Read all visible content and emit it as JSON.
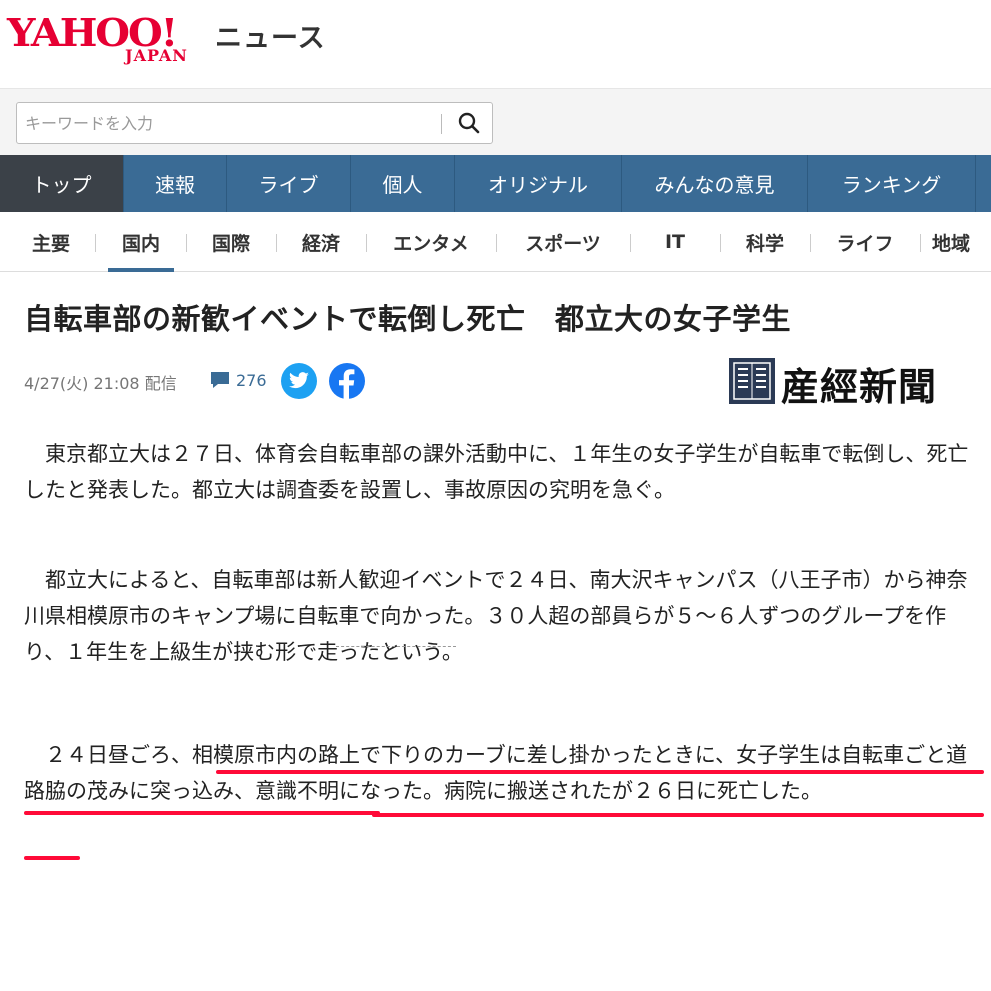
{
  "header": {
    "logo_main": "YAHOO!",
    "logo_sub": "JAPAN",
    "service_name": "ニュース"
  },
  "search": {
    "placeholder": "キーワードを入力",
    "value": "",
    "button_icon": "search-icon"
  },
  "nav_primary": {
    "tabs": [
      {
        "label": "トップ",
        "active": true
      },
      {
        "label": "速報",
        "active": false
      },
      {
        "label": "ライブ",
        "active": false
      },
      {
        "label": "個人",
        "active": false
      },
      {
        "label": "オリジナル",
        "active": false
      },
      {
        "label": "みんなの意見",
        "active": false
      },
      {
        "label": "ランキング",
        "active": false
      }
    ]
  },
  "nav_secondary": {
    "categories": [
      {
        "label": "主要",
        "active": false
      },
      {
        "label": "国内",
        "active": true
      },
      {
        "label": "国際",
        "active": false
      },
      {
        "label": "経済",
        "active": false
      },
      {
        "label": "エンタメ",
        "active": false
      },
      {
        "label": "スポーツ",
        "active": false
      },
      {
        "label": "IT",
        "active": false
      },
      {
        "label": "科学",
        "active": false
      },
      {
        "label": "ライフ",
        "active": false
      },
      {
        "label": "地域",
        "active": false
      }
    ]
  },
  "article": {
    "headline": "自転車部の新歓イベントで転倒し死亡　都立大の女子学生",
    "published": "4/27(火) 21:08 配信",
    "comment_count": "276",
    "source": "産經新聞",
    "paragraphs": [
      "　東京都立大は２７日、体育会自転車部の課外活動中に、１年生の女子学生が自転車で転倒し、死亡したと発表した。都立大は調査委を設置し、事故原因の究明を急ぐ。",
      "　都立大によると、自転車部は新人歓迎イベントで２４日、南大沢キャンパス（八王子市）から神奈川県相模原市のキャンプ場に自転車で向かった。３０人超の部員らが５～６人ずつのグループを作り、１年生を上級生が挟む形で走ったという。",
      "　２４日昼ごろ、相模原市内の路上で下りのカーブに差し掛かったときに、女子学生は自転車ごと道路脇の茂みに突っ込み、意識不明になった。病院に搬送されたが２６日に死亡した。"
    ]
  },
  "colors": {
    "brand_red": "#e60033",
    "nav_blue": "#3a6b95",
    "nav_active": "#3b4148",
    "twitter": "#1da1f2",
    "facebook": "#1877f2",
    "annotation_red": "#ff0a38"
  }
}
